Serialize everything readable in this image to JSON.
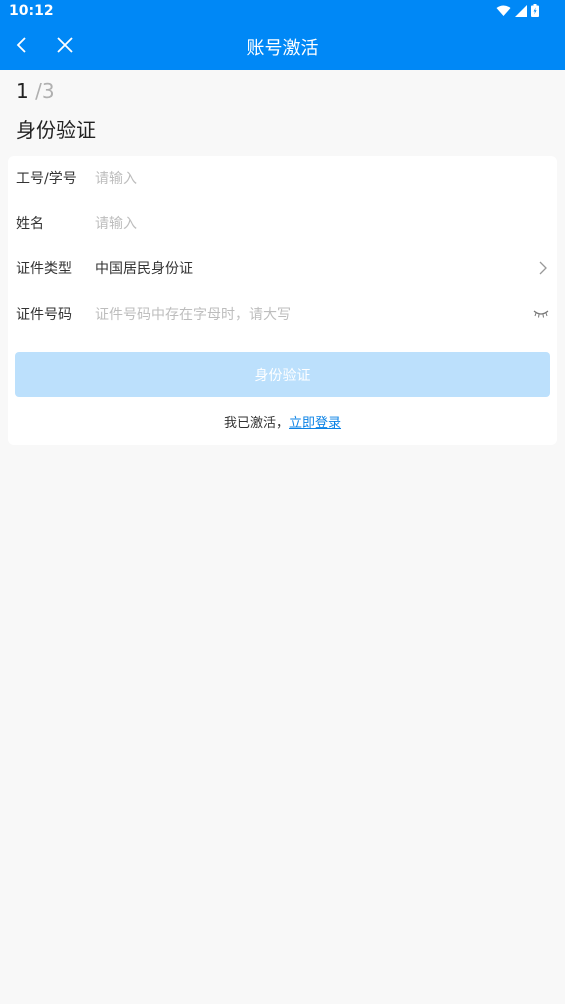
{
  "status_bar": {
    "time": "10:12"
  },
  "nav": {
    "title": "账号激活"
  },
  "step": {
    "current": "1",
    "total": "/3"
  },
  "section_title": "身份验证",
  "form": {
    "fields": [
      {
        "label": "工号/学号",
        "placeholder": "请输入"
      },
      {
        "label": "姓名",
        "placeholder": "请输入"
      },
      {
        "label": "证件类型",
        "value": "中国居民身份证"
      },
      {
        "label": "证件号码",
        "placeholder": "证件号码中存在字母时，请大写"
      }
    ],
    "submit_label": "身份验证"
  },
  "footer": {
    "text": "我已激活，",
    "link": "立即登录"
  },
  "colors": {
    "header": "#0088f6",
    "button_disabled": "#bce0fc",
    "link": "#0a82e6"
  }
}
